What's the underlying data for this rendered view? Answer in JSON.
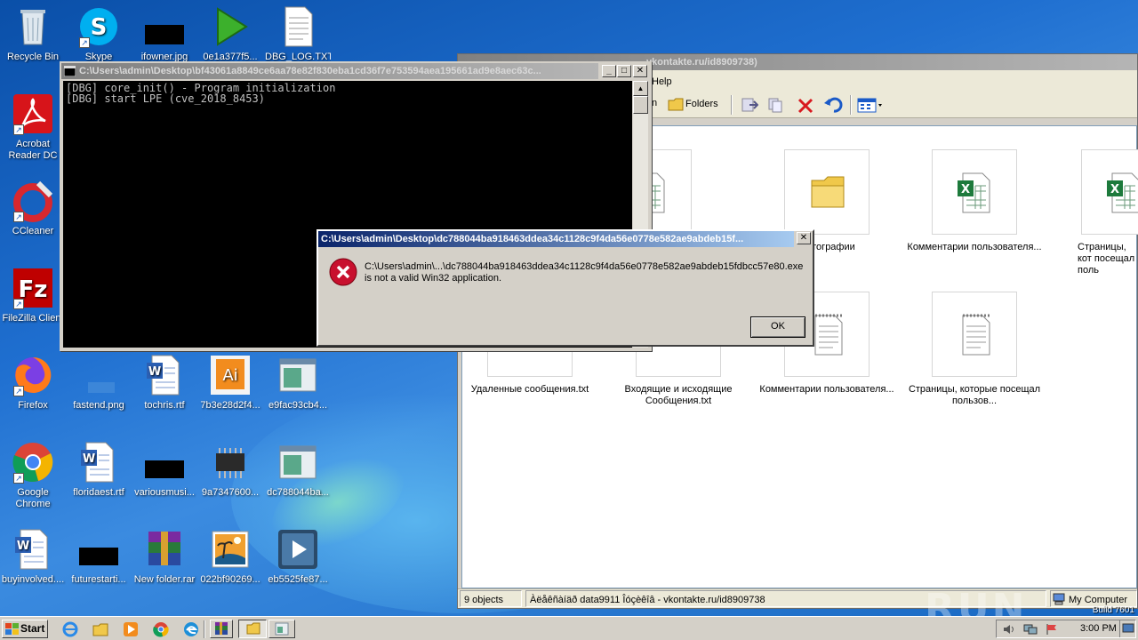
{
  "desktop": {
    "icons": [
      {
        "label": "Recycle Bin",
        "icon": "recycle-bin-icon"
      },
      {
        "label": "Skype",
        "icon": "skype-icon"
      },
      {
        "label": "ifowner.jpg",
        "icon": "image-file-icon"
      },
      {
        "label": "0e1a377f5...",
        "icon": "media-player-icon"
      },
      {
        "label": "DBG_LOG.TXT",
        "icon": "text-file-icon"
      },
      {
        "label": "Acrobat Reader DC",
        "icon": "acrobat-icon"
      },
      {
        "label": "CCleaner",
        "icon": "ccleaner-icon"
      },
      {
        "label": "FileZilla Client",
        "icon": "filezilla-icon"
      },
      {
        "label": "Firefox",
        "icon": "firefox-icon"
      },
      {
        "label": "fastend.png",
        "icon": "image-file-icon"
      },
      {
        "label": "tochris.rtf",
        "icon": "word-doc-icon"
      },
      {
        "label": "7b3e28d2f4...",
        "icon": "illustrator-icon"
      },
      {
        "label": "e9fac93cb4...",
        "icon": "app-window-icon"
      },
      {
        "label": "Google Chrome",
        "icon": "chrome-icon"
      },
      {
        "label": "floridaest.rtf",
        "icon": "word-doc-icon"
      },
      {
        "label": "variousmusi...",
        "icon": "image-file-icon"
      },
      {
        "label": "9a7347600...",
        "icon": "chip-icon"
      },
      {
        "label": "dc788044ba...",
        "icon": "app-window-icon"
      },
      {
        "label": "buyinvolved....",
        "icon": "word-doc-icon"
      },
      {
        "label": "futurestarti...",
        "icon": "image-file-icon"
      },
      {
        "label": "New folder.rar",
        "icon": "winrar-icon"
      },
      {
        "label": "022bf90269...",
        "icon": "image-file-icon"
      },
      {
        "label": "eb5525fe87...",
        "icon": "video-file-icon"
      }
    ]
  },
  "console": {
    "title": "C:\\Users\\admin\\Desktop\\bf43061a8849ce6aa78e82f830eba1cd36f7e753594aea195661ad9e8aec63c...",
    "lines": [
      "[DBG] core_init() - Program initialization",
      "[DBG] start LPE (cve_2018_8453)"
    ]
  },
  "explorer": {
    "title": "vkontakte.ru/id8909738)",
    "menu_help": "Help",
    "toolbar_partial": "n",
    "folders_label": "Folders",
    "files": [
      {
        "label": "",
        "icon": "excel-file-icon"
      },
      {
        "label": "фотографии",
        "icon": "folder-icon"
      },
      {
        "label": "Комментарии пользователя...",
        "icon": "excel-file-icon"
      },
      {
        "label": "Страницы, кот посещал поль",
        "icon": "excel-file-icon"
      },
      {
        "label": "Удаленные сообщения.txt",
        "icon": "text-file-icon"
      },
      {
        "label": "Входящие и исходящие Сообщения.txt",
        "icon": "text-file-icon"
      },
      {
        "label": "Комментарии пользователя...",
        "icon": "text-file-icon"
      },
      {
        "label": "Страницы, которые посещал пользов...",
        "icon": "text-file-icon"
      }
    ],
    "status_count": "9 objects",
    "status_path": "Àëåêñàíäð data9911 Îóçèêîâ - vkontakte.ru/id8909738",
    "status_zone": "My Computer"
  },
  "dialog": {
    "title": "C:\\Users\\admin\\Desktop\\dc788044ba918463ddea34c1128c9f4da56e0778e582ae9abdeb15f...",
    "message_line1": "C:\\Users\\admin\\...\\dc788044ba918463ddea34c1128c9f4da56e0778e582ae9abdeb15fdbcc57e80.exe",
    "message_line2": "is not a valid Win32 application.",
    "ok_label": "OK"
  },
  "taskbar": {
    "start_label": "Start",
    "clock": "3:00 PM"
  },
  "watermark": "ANY RUN",
  "build": "Build 7601",
  "colors": {
    "desktop_blue": "#1f6fd0",
    "active_title": "#0a246a",
    "error_red": "#c8102e"
  }
}
